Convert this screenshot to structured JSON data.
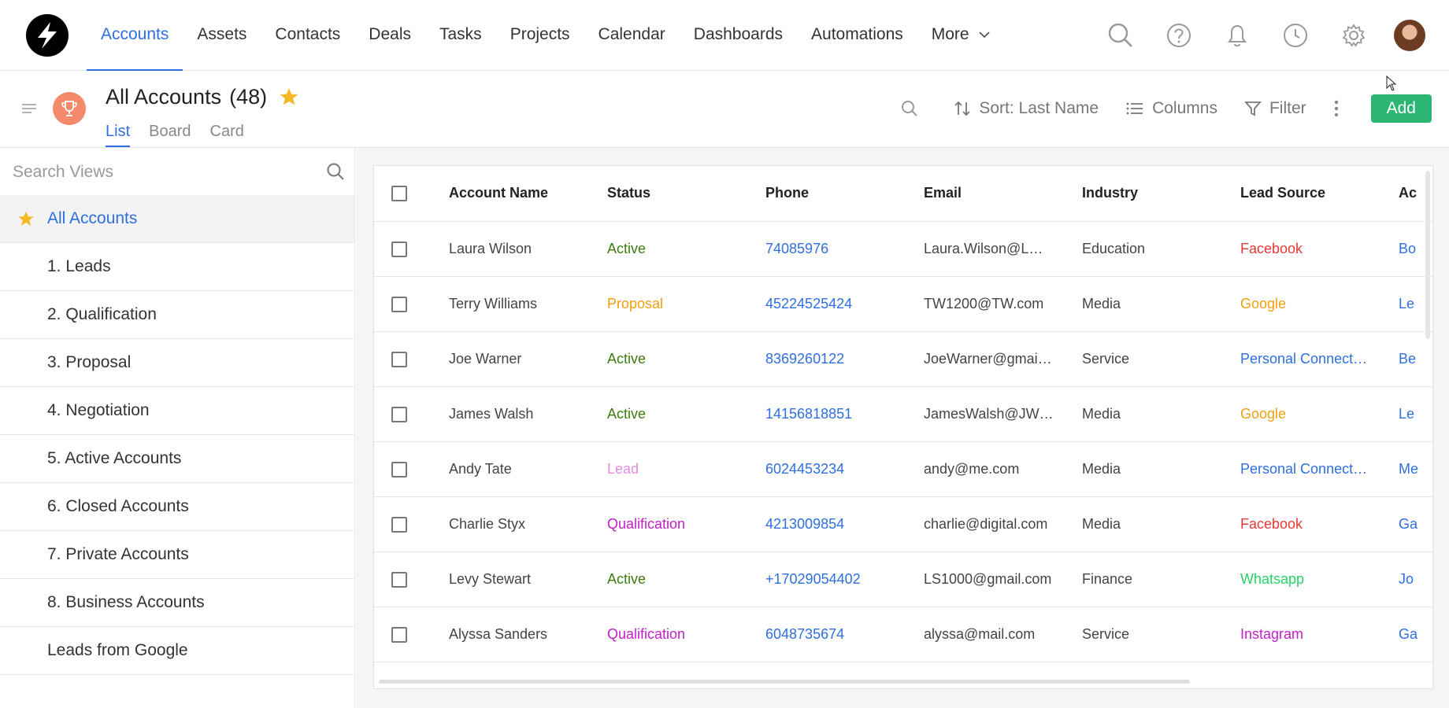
{
  "nav": {
    "items": [
      {
        "label": "Accounts",
        "active": true
      },
      {
        "label": "Assets"
      },
      {
        "label": "Contacts"
      },
      {
        "label": "Deals"
      },
      {
        "label": "Tasks"
      },
      {
        "label": "Projects"
      },
      {
        "label": "Calendar"
      },
      {
        "label": "Dashboards"
      },
      {
        "label": "Automations"
      }
    ],
    "more_label": "More",
    "icons": [
      "search-icon",
      "help-icon",
      "bell-icon",
      "clock-icon",
      "gear-icon",
      "avatar"
    ]
  },
  "header": {
    "title": "All Accounts",
    "count": "(48)",
    "tabs": [
      {
        "label": "List",
        "active": true
      },
      {
        "label": "Board"
      },
      {
        "label": "Card"
      }
    ],
    "sort_label": "Sort: Last Name",
    "columns_label": "Columns",
    "filter_label": "Filter",
    "add_label": "Add"
  },
  "sidebar": {
    "search_placeholder": "Search Views",
    "views": [
      {
        "label": "All Accounts",
        "active": true
      },
      {
        "label": "1. Leads"
      },
      {
        "label": "2. Qualification"
      },
      {
        "label": "3. Proposal"
      },
      {
        "label": "4. Negotiation"
      },
      {
        "label": "5. Active Accounts"
      },
      {
        "label": "6. Closed Accounts"
      },
      {
        "label": "7. Private Accounts"
      },
      {
        "label": "8. Business Accounts"
      },
      {
        "label": "Leads from Google"
      }
    ]
  },
  "table": {
    "columns": [
      "Account Name",
      "Status",
      "Phone",
      "Email",
      "Industry",
      "Lead Source",
      "Ac"
    ],
    "rows": [
      {
        "name": "Laura Wilson",
        "status": "Active",
        "phone": "74085976",
        "email": "Laura.Wilson@L…",
        "industry": "Education",
        "source": "Facebook",
        "owner": "Bo"
      },
      {
        "name": "Terry Williams",
        "status": "Proposal",
        "phone": "45224525424",
        "email": "TW1200@TW.com",
        "industry": "Media",
        "source": "Google",
        "owner": "Le"
      },
      {
        "name": "Joe Warner",
        "status": "Active",
        "phone": "8369260122",
        "email": "JoeWarner@gmai…",
        "industry": "Service",
        "source": "Personal Connect…",
        "owner": "Be"
      },
      {
        "name": "James Walsh",
        "status": "Active",
        "phone": "14156818851",
        "email": "JamesWalsh@JW…",
        "industry": "Media",
        "source": "Google",
        "owner": "Le"
      },
      {
        "name": "Andy Tate",
        "status": "Lead",
        "phone": "6024453234",
        "email": "andy@me.com",
        "industry": "Media",
        "source": "Personal Connect…",
        "owner": "Me"
      },
      {
        "name": "Charlie Styx",
        "status": "Qualification",
        "phone": "4213009854",
        "email": "charlie@digital.com",
        "industry": "Media",
        "source": "Facebook",
        "owner": "Ga"
      },
      {
        "name": "Levy Stewart",
        "status": "Active",
        "phone": "+17029054402",
        "email": "LS1000@gmail.com",
        "industry": "Finance",
        "source": "Whatsapp",
        "owner": "Jo"
      },
      {
        "name": "Alyssa Sanders",
        "status": "Qualification",
        "phone": "6048735674",
        "email": "alyssa@mail.com",
        "industry": "Service",
        "source": "Instagram",
        "owner": "Ga"
      }
    ]
  },
  "colors": {
    "accent": "#2f6fe0",
    "add_button": "#2bb673",
    "status": {
      "Active": "#3b7d0e",
      "Proposal": "#f0a010",
      "Lead": "#e58be0",
      "Qualification": "#c21fc8"
    },
    "source": {
      "Facebook": "#e53935",
      "Google": "#f0a010",
      "Personal Connect…": "#2f6fe0",
      "Whatsapp": "#25d366",
      "Instagram": "#c21fc8"
    },
    "phone": "#2f6fe0",
    "owner": "#2f6fe0",
    "star": "#f6b820"
  }
}
